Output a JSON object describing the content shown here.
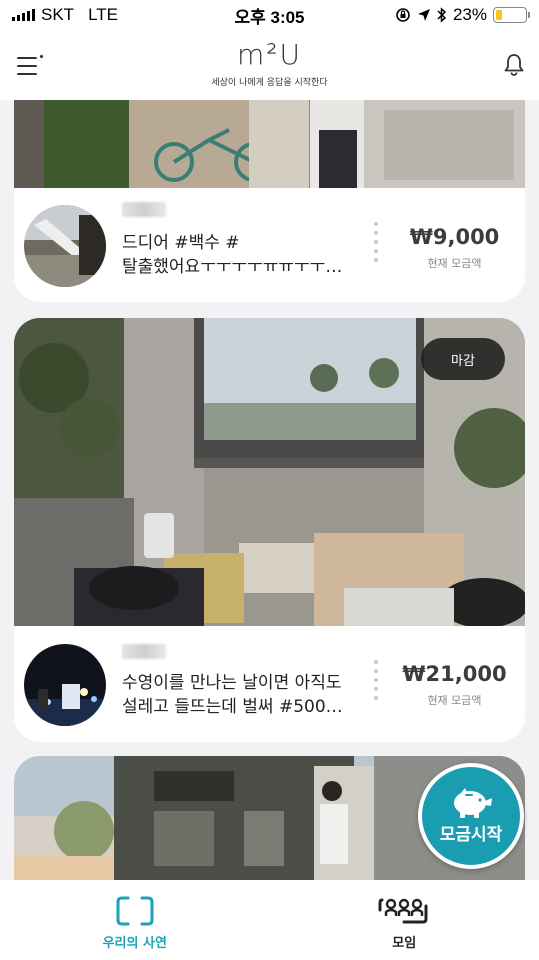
{
  "status_bar": {
    "carrier": "SKT",
    "network": "LTE",
    "time": "오후 3:05",
    "battery_percent": "23%",
    "battery_level": 0.23
  },
  "header": {
    "logo": "m²U",
    "tagline": "세상이 나에게 응답을 시작한다"
  },
  "cards": [
    {
      "caption_line1": "드디어 #백수 #",
      "caption_line2": "탈출했어요ㅜㅜㅜㅜㅠㅠㅜㅜ…",
      "amount": "₩9,000",
      "amount_label": "현재 모금액"
    },
    {
      "badge": "마감",
      "caption_line1": "수영이를 만나는 날이면 아직도",
      "caption_line2": "설레고 들뜨는데 벌써 #500…",
      "amount": "₩21,000",
      "amount_label": "현재 모금액"
    }
  ],
  "fab": {
    "label": "모금시작",
    "icon": "piggy-bank-icon"
  },
  "tab_bar": {
    "tabs": [
      {
        "label": "우리의 사연",
        "icon": "frame-icon",
        "active": true
      },
      {
        "label": "모임",
        "icon": "group-icon",
        "active": false
      }
    ]
  },
  "colors": {
    "accent": "#1aa2b8",
    "fab": "#1a9db1",
    "background": "#f2f1f4",
    "battery": "#f5c518"
  }
}
